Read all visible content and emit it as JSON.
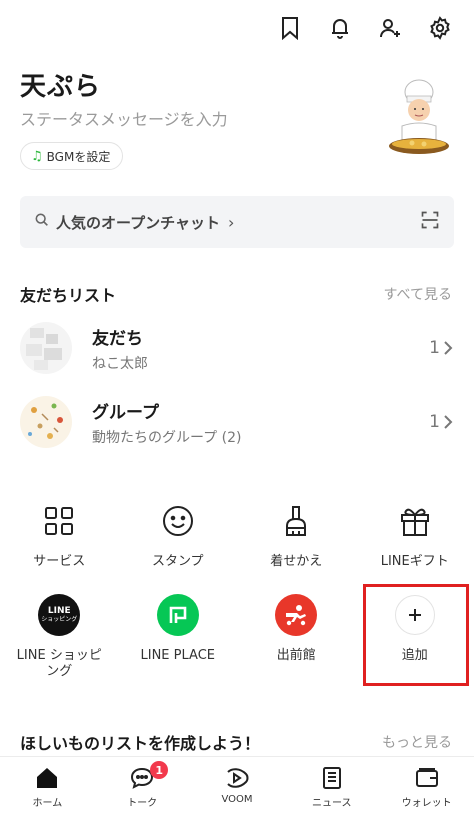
{
  "header": {
    "icons": [
      "bookmark-icon",
      "bell-icon",
      "add-friend-icon",
      "settings-icon"
    ]
  },
  "profile": {
    "name": "天ぷら",
    "status_placeholder": "ステータスメッセージを入力",
    "bgm_label": "BGMを設定"
  },
  "search": {
    "label": "人気のオープンチャット",
    "chevron": "›"
  },
  "friends_section": {
    "title": "友だちリスト",
    "see_all": "すべて見る",
    "rows": [
      {
        "title": "友だち",
        "subtitle": "ねこ太郎",
        "count": "1"
      },
      {
        "title": "グループ",
        "subtitle": "動物たちのグループ (2)",
        "count": "1"
      }
    ]
  },
  "services_row1": [
    {
      "label": "サービス",
      "icon": "grid-icon"
    },
    {
      "label": "スタンプ",
      "icon": "smile-icon"
    },
    {
      "label": "着せかえ",
      "icon": "brush-icon"
    },
    {
      "label": "LINEギフト",
      "icon": "gift-icon"
    }
  ],
  "services_row2": [
    {
      "label": "LINE ショッピング",
      "icon": "line-shopping-icon",
      "logo_text_1": "LINE",
      "logo_text_2": "ショッピング"
    },
    {
      "label": "LINE PLACE",
      "icon": "line-place-icon"
    },
    {
      "label": "出前館",
      "icon": "demaekan-icon"
    },
    {
      "label": "追加",
      "icon": "plus-icon"
    }
  ],
  "wishlist": {
    "title": "ほしいものリストを作成しよう！",
    "more": "もっと見る"
  },
  "tabbar": {
    "tabs": [
      {
        "label": "ホーム",
        "icon": "home-icon"
      },
      {
        "label": "トーク",
        "icon": "chat-icon",
        "badge": "1"
      },
      {
        "label": "VOOM",
        "icon": "voom-icon"
      },
      {
        "label": "ニュース",
        "icon": "news-icon"
      },
      {
        "label": "ウォレット",
        "icon": "wallet-icon"
      }
    ]
  },
  "colors": {
    "line_green": "#06c755",
    "badge_red": "#f2394c",
    "demaekan_red": "#e8372a",
    "highlight_red": "#e02020"
  }
}
